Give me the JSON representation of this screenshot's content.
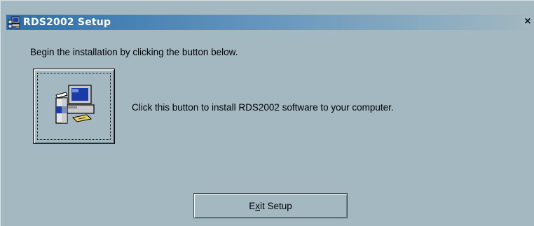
{
  "window": {
    "title": "RDS2002 Setup",
    "close_glyph": "×",
    "title_icon": "setup-computer-icon",
    "close_icon": "close-icon"
  },
  "content": {
    "intro_text": "Begin the installation by clicking the button below.",
    "install_button_icon": "install-computer-icon",
    "install_label": "Click this button to install RDS2002 software to your computer.",
    "exit_button": {
      "label_pre": "E",
      "label_mnemonic": "x",
      "label_post": "it Setup"
    }
  },
  "colors": {
    "window_bg": "#a3b8c0",
    "title_start": "#2c6faa",
    "title_end": "#a3b8c0",
    "title_text": "#ffffff"
  }
}
